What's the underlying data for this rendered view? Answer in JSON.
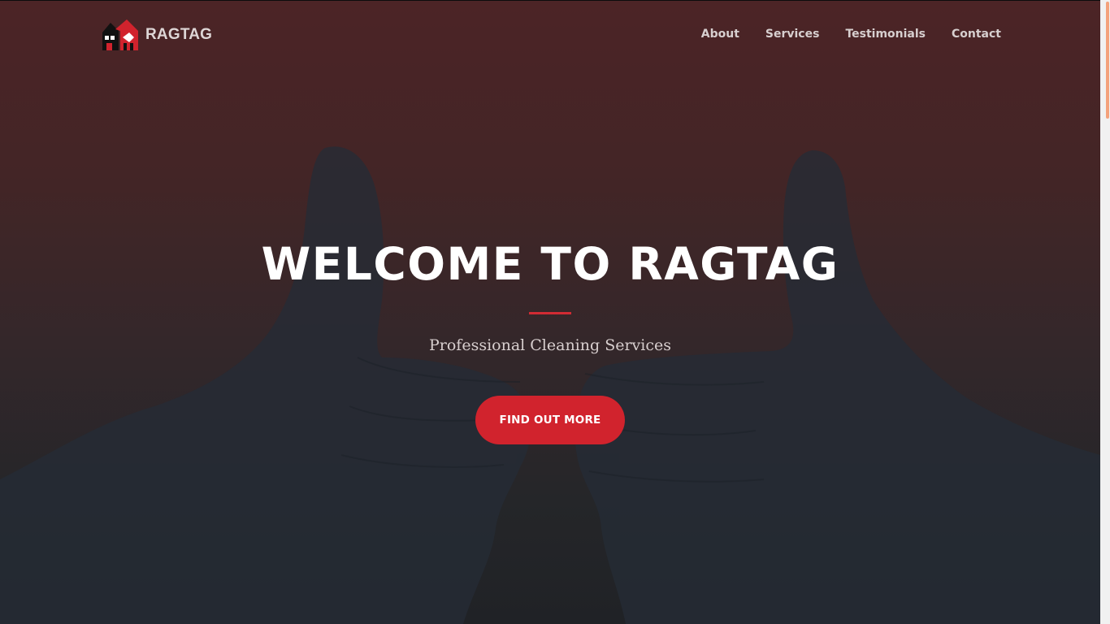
{
  "navbar": {
    "brand": "RAGTAG",
    "links": [
      "About",
      "Services",
      "Testimonials",
      "Contact"
    ]
  },
  "hero": {
    "title": "WELCOME TO RAGTAG",
    "subtitle": "Professional Cleaning Services",
    "cta_label": "FIND OUT MORE"
  },
  "colors": {
    "accent": "#d1232d",
    "overlay_top": "#4c2426",
    "overlay_bottom": "#202226",
    "scrollbar_thumb": "#f4a27c"
  },
  "icons": {
    "brand_logo": "ragtag-logo-icon",
    "background": "gloved-thumbs-up-image"
  }
}
